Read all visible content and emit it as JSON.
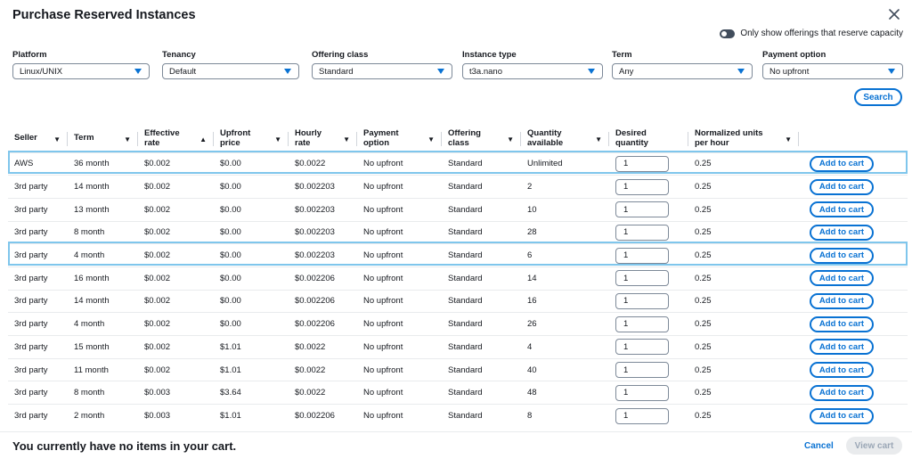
{
  "modal": {
    "title": "Purchase Reserved Instances",
    "toggle_label": "Only show offerings that reserve capacity"
  },
  "filters": [
    {
      "label": "Platform",
      "value": "Linux/UNIX"
    },
    {
      "label": "Tenancy",
      "value": "Default"
    },
    {
      "label": "Offering class",
      "value": "Standard"
    },
    {
      "label": "Instance type",
      "value": "t3a.nano"
    },
    {
      "label": "Term",
      "value": "Any"
    },
    {
      "label": "Payment option",
      "value": "No upfront"
    }
  ],
  "search_label": "Search",
  "table": {
    "columns": [
      {
        "label": "Seller",
        "sort": "▼"
      },
      {
        "label": "Term",
        "sort": "▼"
      },
      {
        "label": "Effective rate",
        "sort": "▲"
      },
      {
        "label": "Upfront price",
        "sort": "▼"
      },
      {
        "label": "Hourly rate",
        "sort": "▼"
      },
      {
        "label": "Payment option",
        "sort": "▼"
      },
      {
        "label": "Offering class",
        "sort": "▼"
      },
      {
        "label": "Quantity available",
        "sort": "▼"
      },
      {
        "label": "Desired quantity",
        "sort": ""
      },
      {
        "label": "Normalized units per hour",
        "sort": "▼"
      },
      {
        "label": "",
        "sort": ""
      }
    ],
    "add_label": "Add to cart",
    "rows": [
      {
        "seller": "AWS",
        "term": "36 month",
        "effective": "$0.002",
        "upfront": "$0.00",
        "hourly": "$0.0022",
        "payment": "No upfront",
        "offering": "Standard",
        "available": "Unlimited",
        "desired": "1",
        "units": "0.25"
      },
      {
        "seller": "3rd party",
        "term": "14 month",
        "effective": "$0.002",
        "upfront": "$0.00",
        "hourly": "$0.002203",
        "payment": "No upfront",
        "offering": "Standard",
        "available": "2",
        "desired": "1",
        "units": "0.25"
      },
      {
        "seller": "3rd party",
        "term": "13 month",
        "effective": "$0.002",
        "upfront": "$0.00",
        "hourly": "$0.002203",
        "payment": "No upfront",
        "offering": "Standard",
        "available": "10",
        "desired": "1",
        "units": "0.25"
      },
      {
        "seller": "3rd party",
        "term": "8 month",
        "effective": "$0.002",
        "upfront": "$0.00",
        "hourly": "$0.002203",
        "payment": "No upfront",
        "offering": "Standard",
        "available": "28",
        "desired": "1",
        "units": "0.25"
      },
      {
        "seller": "3rd party",
        "term": "4 month",
        "effective": "$0.002",
        "upfront": "$0.00",
        "hourly": "$0.002203",
        "payment": "No upfront",
        "offering": "Standard",
        "available": "6",
        "desired": "1",
        "units": "0.25"
      },
      {
        "seller": "3rd party",
        "term": "16 month",
        "effective": "$0.002",
        "upfront": "$0.00",
        "hourly": "$0.002206",
        "payment": "No upfront",
        "offering": "Standard",
        "available": "14",
        "desired": "1",
        "units": "0.25"
      },
      {
        "seller": "3rd party",
        "term": "14 month",
        "effective": "$0.002",
        "upfront": "$0.00",
        "hourly": "$0.002206",
        "payment": "No upfront",
        "offering": "Standard",
        "available": "16",
        "desired": "1",
        "units": "0.25"
      },
      {
        "seller": "3rd party",
        "term": "4 month",
        "effective": "$0.002",
        "upfront": "$0.00",
        "hourly": "$0.002206",
        "payment": "No upfront",
        "offering": "Standard",
        "available": "26",
        "desired": "1",
        "units": "0.25"
      },
      {
        "seller": "3rd party",
        "term": "15 month",
        "effective": "$0.002",
        "upfront": "$1.01",
        "hourly": "$0.0022",
        "payment": "No upfront",
        "offering": "Standard",
        "available": "4",
        "desired": "1",
        "units": "0.25"
      },
      {
        "seller": "3rd party",
        "term": "11 month",
        "effective": "$0.002",
        "upfront": "$1.01",
        "hourly": "$0.0022",
        "payment": "No upfront",
        "offering": "Standard",
        "available": "40",
        "desired": "1",
        "units": "0.25"
      },
      {
        "seller": "3rd party",
        "term": "8 month",
        "effective": "$0.003",
        "upfront": "$3.64",
        "hourly": "$0.0022",
        "payment": "No upfront",
        "offering": "Standard",
        "available": "48",
        "desired": "1",
        "units": "0.25"
      },
      {
        "seller": "3rd party",
        "term": "2 month",
        "effective": "$0.003",
        "upfront": "$1.01",
        "hourly": "$0.002206",
        "payment": "No upfront",
        "offering": "Standard",
        "available": "8",
        "desired": "1",
        "units": "0.25"
      }
    ]
  },
  "footer": {
    "message": "You currently have no items in your cart.",
    "cancel": "Cancel",
    "view_cart": "View cart"
  },
  "colors": {
    "accent": "#0972d3",
    "highlight": "#7fc6ec"
  }
}
